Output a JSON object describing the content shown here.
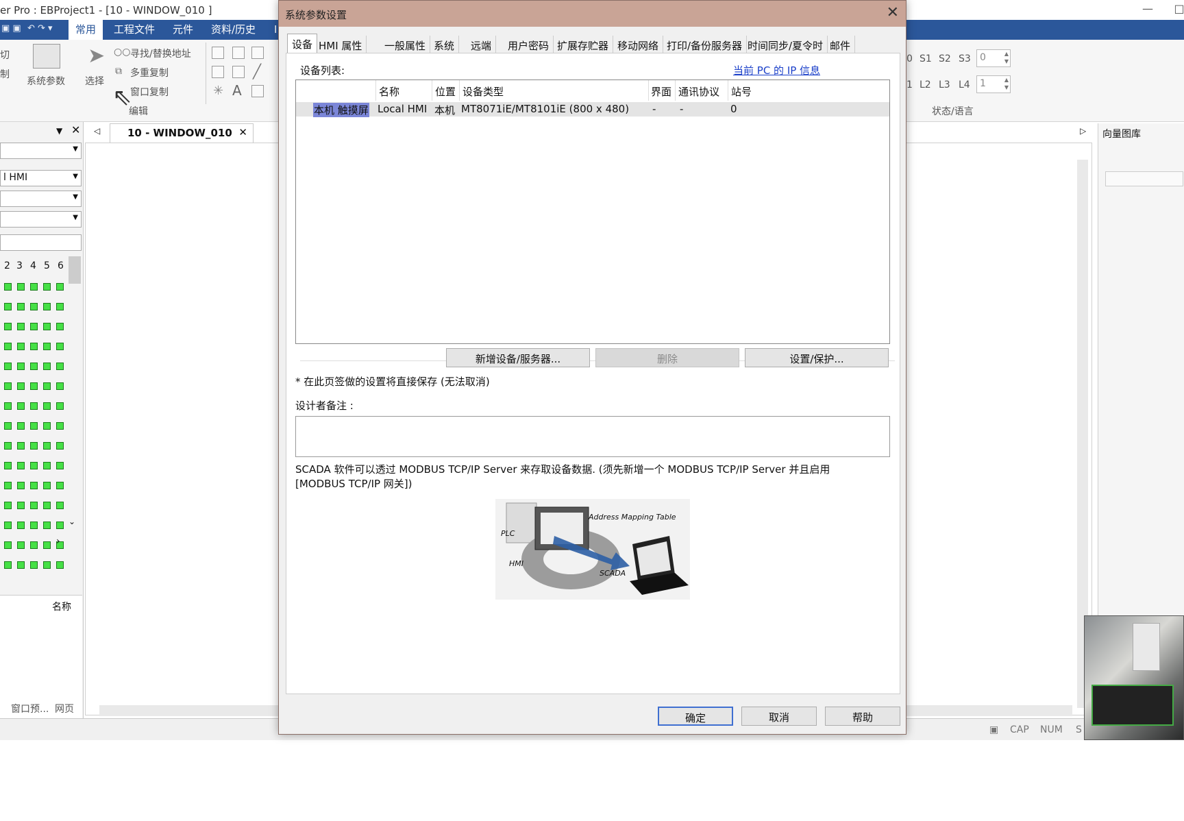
{
  "app": {
    "title": "er Pro : EBProject1 - [10 - WINDOW_010 ]",
    "min": "—",
    "max": "□",
    "ribbon_tabs": [
      "常用",
      "工程文件",
      "元件",
      "资料/历史",
      "I"
    ],
    "ribbon": {
      "cut": "切",
      "copy": "制",
      "system_params": "系统参数",
      "select": "选择",
      "find_replace": "寻找/替换地址",
      "multi_copy": "多重复制",
      "window_copy": "窗口复制",
      "edit_group": "编辑",
      "state_row1": [
        "0",
        "S1",
        "S2",
        "S3"
      ],
      "state_row2": [
        "1",
        "L2",
        "L3",
        "L4"
      ],
      "state_spin1": "0",
      "state_spin2": "1",
      "state_lang": "状态/语言"
    },
    "left_panel": {
      "dropdown2": "l HMI",
      "grid_numbers": [
        "2",
        "3",
        "4",
        "5",
        "6"
      ],
      "name_col": "名称",
      "bottom_tabs": [
        "窗口预...",
        "网页"
      ]
    },
    "doc_tab": "10 - WINDOW_010",
    "right_panel_title": "向量图库",
    "status": {
      "cap": "CAP",
      "num": "NUM",
      "s": "S"
    }
  },
  "dialog": {
    "title": "系统参数设置",
    "tabs": [
      "设备",
      "HMI 属性",
      "一般属性",
      "系统",
      "远端",
      "用户密码",
      "扩展存贮器",
      "移动网络",
      "打印/备份服务器",
      "时间同步/夏令时",
      "邮件"
    ],
    "device_list_label": "设备列表:",
    "pc_ip_link": "当前 PC 的 IP 信息",
    "table": {
      "headers": [
        "名称",
        "位置",
        "设备类型",
        "界面",
        "通讯协议",
        "站号"
      ],
      "rows": [
        {
          "tag": "本机 触摸屏",
          "name": "Local HMI",
          "location": "本机",
          "type": "MT8071iE/MT8101iE (800 x 480)",
          "interface": "-",
          "protocol": "-",
          "station": "0"
        }
      ]
    },
    "btn_add": "新增设备/服务器...",
    "btn_delete": "删除",
    "btn_settings": "设置/保护...",
    "note": "* 在此页签做的设置将直接保存 (无法取消)",
    "memo_label": "设计者备注 :",
    "scada_text_1": "SCADA 软件可以透过 MODBUS TCP/IP Server 来存取设备数据. (须先新增一个 MODBUS TCP/IP Server 并且启用",
    "scada_text_2": "[MODBUS TCP/IP 网关])",
    "diagram": {
      "plc": "PLC",
      "hmi": "HMI",
      "scada": "SCADA",
      "amt": "Address Mapping Table"
    },
    "btn_ok": "确定",
    "btn_cancel": "取消",
    "btn_help": "帮助"
  },
  "colors": {
    "ribbon_blue": "#2b579a",
    "dialog_title": "#c9a496",
    "selection": "#7b86d8",
    "link": "#1a3fc9"
  }
}
